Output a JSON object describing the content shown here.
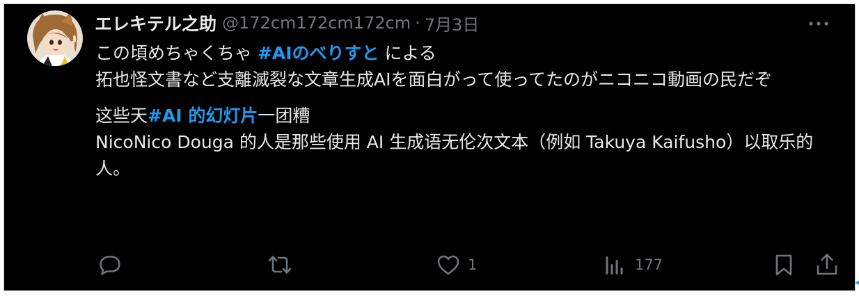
{
  "tweet": {
    "author": {
      "display_name": "エレキテル之助",
      "handle": "@172cm172cm172cm",
      "separator": "·",
      "date": "7月3日"
    },
    "body": {
      "p1_line1_before": "この頃めちゃくちゃ ",
      "p1_hashtag": "#AIのべりすと",
      "p1_line1_after": " による",
      "p1_rest": "拓也怪文書など支離滅裂な文章生成AIを面白がって使ってたのがニコニコ動画の民だぞ",
      "p2_before": "这些天",
      "p2_hashtag": "#AI 的幻灯片",
      "p2_line1_after": "一团糟",
      "p2_rest": "NicoNico Douga 的人是那些使用 AI 生成语无伦次文本（例如 Takuya Kaifusho）以取乐的人。"
    },
    "actions": {
      "reply_icon": "reply-icon",
      "retweet_icon": "retweet-icon",
      "like_icon": "heart-icon",
      "like_count": "1",
      "views_icon": "views-icon",
      "views_count": "177",
      "bookmark_icon": "bookmark-icon",
      "share_icon": "share-icon"
    },
    "more_icon": "more-options-icon"
  },
  "colors": {
    "background": "#000000",
    "text": "#e7e9ea",
    "muted": "#71767b",
    "accent": "#1d9bf0"
  }
}
